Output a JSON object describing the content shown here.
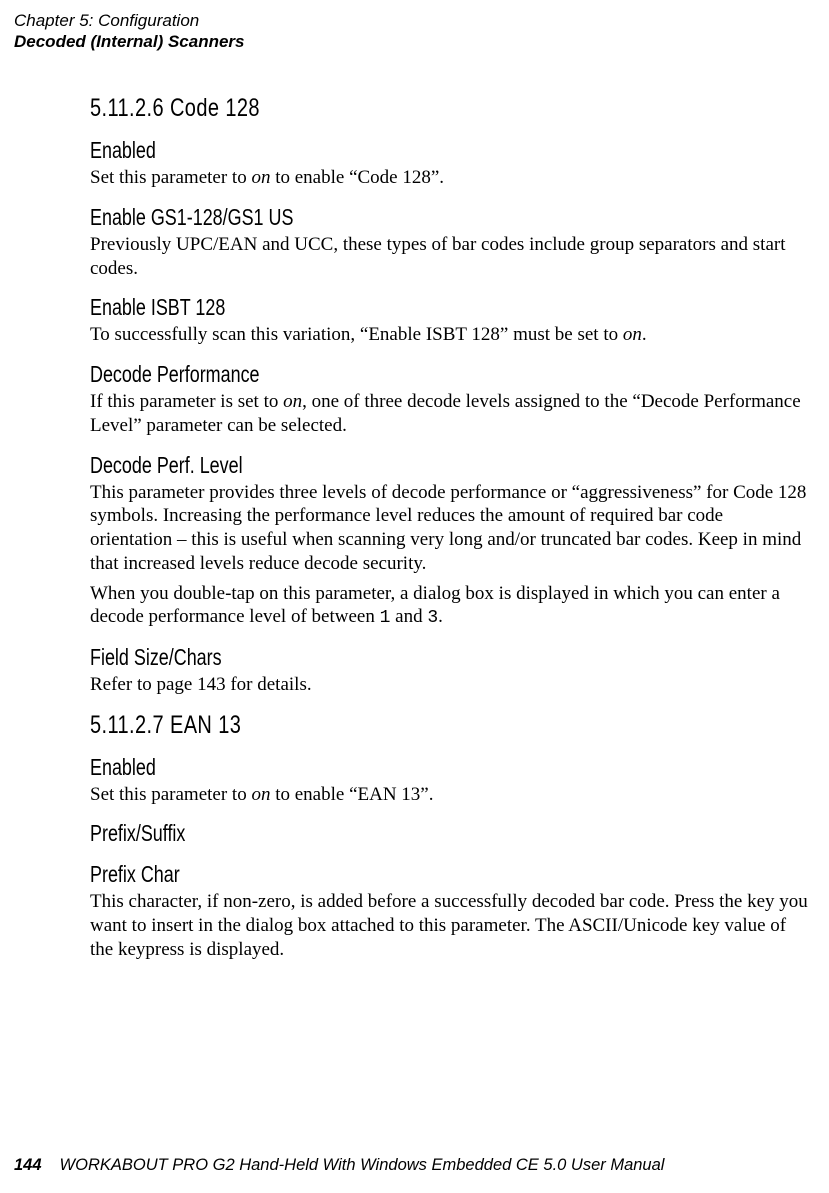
{
  "running_head": {
    "line1": "Chapter 5: Configuration",
    "line2": "Decoded (Internal) Scanners"
  },
  "sections": {
    "s1": {
      "heading": "5.11.2.6 Code 128",
      "sub1_h": "Enabled",
      "sub1_p_a": "Set this parameter to ",
      "sub1_p_b": "on",
      "sub1_p_c": " to enable “Code 128”.",
      "sub2_h": "Enable GS1-128/GS1 US",
      "sub2_p_a": "Previously UPC/EAN and ",
      "sub2_p_b": "UCC",
      "sub2_p_c": ", these types of bar codes include group separators and start codes.",
      "sub3_h": "Enable ISBT 128",
      "sub3_p_a": "To successfully scan this variation, “Enable ISBT 128” must be set to ",
      "sub3_p_b": "on",
      "sub3_p_c": ".",
      "sub4_h": "Decode Performance",
      "sub4_p_a": "If this parameter is set to ",
      "sub4_p_b": "on",
      "sub4_p_c": ", one of three decode levels assigned to the “Decode Performance Level” parameter can be selected.",
      "sub5_h": "Decode Perf. Level",
      "sub5_p1": "This parameter provides three levels of decode performance or “aggressiveness” for Code 128 symbols. Increasing the performance level reduces the amount of required bar code orientation – this is useful when scanning very long and/or truncated bar codes. Keep in mind that increased levels reduce decode security.",
      "sub5_p2_a": "When you double-tap on this parameter, a dialog box is displayed in which you can enter a decode performance level of between ",
      "sub5_p2_b": "1",
      "sub5_p2_c": " and ",
      "sub5_p2_d": "3",
      "sub5_p2_e": ".",
      "sub6_h": "Field Size/Chars",
      "sub6_p": "Refer to page 143 for details."
    },
    "s2": {
      "heading": "5.11.2.7 EAN 13",
      "sub1_h": "Enabled",
      "sub1_p_a": "Set this parameter to ",
      "sub1_p_b": "on",
      "sub1_p_c": " to enable “EAN 13”.",
      "sub2_h": "Prefix/Suffix",
      "sub3_h": "Prefix Char",
      "sub3_p": "This character, if non-zero, is added before a successfully decoded bar code. Press the key you want to insert in the dialog box attached to this parameter. The ASCII/Unicode key value of the keypress is displayed."
    }
  },
  "footer": {
    "page": "144",
    "text": "WORKABOUT PRO G2 Hand-Held With Windows Embedded CE 5.0 User Manual"
  }
}
